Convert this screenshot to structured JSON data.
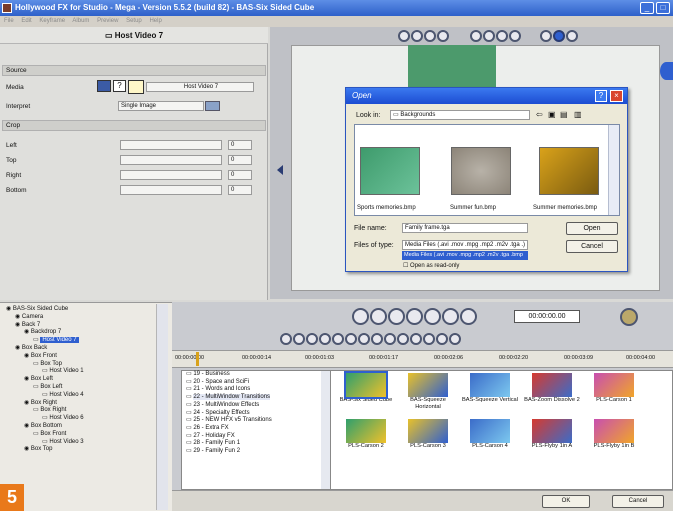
{
  "window": {
    "title": "Hollywood FX for Studio - Mega - Version 5.5.2 (build 82) - BAS-Six Sided Cube"
  },
  "menu": [
    "File",
    "Edit",
    "Keyframe",
    "Album",
    "Preview",
    "Setup",
    "Help"
  ],
  "panel": {
    "title": "Host Video 7",
    "source_label": "Source",
    "media_label": "Media",
    "media_value": "Host Video 7",
    "interpret_label": "Interpret",
    "interpret_value": "Single Image",
    "crop_label": "Crop",
    "crop_rows": [
      {
        "label": "Left",
        "value": "0"
      },
      {
        "label": "Top",
        "value": "0"
      },
      {
        "label": "Right",
        "value": "0"
      },
      {
        "label": "Bottom",
        "value": "0"
      }
    ]
  },
  "dialog": {
    "title": "Open",
    "look_in_label": "Look in:",
    "look_in_value": "Backgrounds",
    "thumbs": [
      "Sports memories.bmp",
      "Summer fun.bmp",
      "Summer memories.bmp"
    ],
    "filename_label": "File name:",
    "filename_value": "Family frame.tga",
    "filetype_label": "Files of type:",
    "filetype_value": "Media Files (.avi .mov .mpg .mp2 .m2v .tga .)",
    "filetype_option": "Media Files (.avi .mov .mpg .mp2 .m2v .tga .bmp",
    "readonly_label": "Open as read-only",
    "open_btn": "Open",
    "cancel_btn": "Cancel"
  },
  "tree": [
    {
      "indent": 0,
      "text": "BAS-Six Sided Cube"
    },
    {
      "indent": 1,
      "text": "Camera"
    },
    {
      "indent": 1,
      "text": "Back 7"
    },
    {
      "indent": 2,
      "text": "Backdrop 7"
    },
    {
      "indent": 3,
      "text": "Host Video 7",
      "selected": true
    },
    {
      "indent": 1,
      "text": "Box Back"
    },
    {
      "indent": 2,
      "text": "Box Front"
    },
    {
      "indent": 3,
      "text": "Box Top"
    },
    {
      "indent": 4,
      "text": "Host Video 1"
    },
    {
      "indent": 2,
      "text": "Box Left"
    },
    {
      "indent": 3,
      "text": "Box Left"
    },
    {
      "indent": 4,
      "text": "Host Video 4"
    },
    {
      "indent": 2,
      "text": "Box Right"
    },
    {
      "indent": 3,
      "text": "Box Right"
    },
    {
      "indent": 4,
      "text": "Host Video 6"
    },
    {
      "indent": 2,
      "text": "Box Bottom"
    },
    {
      "indent": 3,
      "text": "Box Front"
    },
    {
      "indent": 4,
      "text": "Host Video 3"
    },
    {
      "indent": 2,
      "text": "Box Top"
    }
  ],
  "timecode": "00:00:00.00",
  "timeline_ticks": [
    "00:00:00:00",
    "00:00:00:14",
    "00:00:01:03",
    "00:00:01:17",
    "00:00:02:06",
    "00:00:02:20",
    "00:00:03:09",
    "00:00:04:00"
  ],
  "fx_list": [
    "19 - Business",
    "20 - Space and SciFi",
    "21 - Words and Icons",
    "22 - MultiWindow Transitions",
    "23 - MultiWindow Effects",
    "24 - Specialty Effects",
    "25 - NEW HFX v5 Transitions",
    "26 - Extra FX",
    "27 - Holiday FX",
    "28 - Family Fun 1",
    "29 - Family Fun 2"
  ],
  "fx_grid": [
    "BAS-Six Sided Cube",
    "BAS-Squeeze Horizontal",
    "BAS-Squeeze Vertical",
    "BAS-Zoom Dissolve 2",
    "PLS-Carson 1",
    "PLS-Carson 2",
    "PLS-Carson 3",
    "PLS-Carson 4",
    "PLS-Flyby 1in A",
    "PLS-Flyby 1in B"
  ],
  "ok_btn": "OK",
  "cancel_btn": "Cancel",
  "step_badge": "5",
  "colors": {
    "accent": "#2f5fcf",
    "badge": "#e9791a"
  }
}
